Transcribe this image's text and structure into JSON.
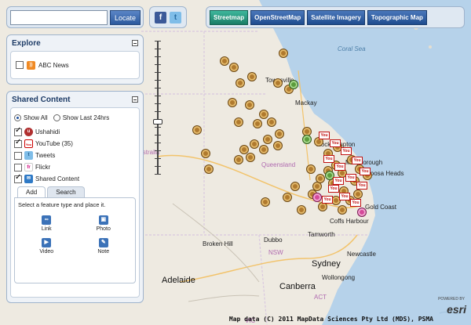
{
  "search": {
    "placeholder": "",
    "value": "",
    "locate_label": "Locate"
  },
  "social": {
    "facebook_glyph": "f",
    "twitter_glyph": "t"
  },
  "basemaps": [
    {
      "label": "Streetmap",
      "active": true
    },
    {
      "label": "OpenStreetMap",
      "active": false
    },
    {
      "label": "Satellite Imagery",
      "active": false
    },
    {
      "label": "Topographic Map",
      "active": false
    }
  ],
  "explore": {
    "title": "Explore",
    "items": [
      {
        "label": "ABC News",
        "checked": false,
        "icon": "rss-icon"
      }
    ]
  },
  "shared": {
    "title": "Shared Content",
    "filters": [
      {
        "label": "Show All",
        "selected": true
      },
      {
        "label": "Show Last 24hrs",
        "selected": false
      }
    ],
    "items": [
      {
        "label": "Ushahidi",
        "checked": true,
        "icon": "ushahidi-icon"
      },
      {
        "label": "YouTube (35)",
        "checked": true,
        "icon": "youtube-icon"
      },
      {
        "label": "Tweets",
        "checked": false,
        "icon": "tweets-icon"
      },
      {
        "label": "Flickr",
        "checked": false,
        "icon": "flickr-icon"
      },
      {
        "label": "Shared Content",
        "checked": true,
        "icon": "shared-icon"
      }
    ],
    "tabs": [
      {
        "label": "Add",
        "active": true
      },
      {
        "label": "Search",
        "active": false
      }
    ],
    "instructions": "Select a feature type and place it.",
    "features": [
      {
        "label": "Link"
      },
      {
        "label": "Photo"
      },
      {
        "label": "Video"
      },
      {
        "label": "Note"
      }
    ]
  },
  "map": {
    "labels": {
      "coral_sea": "Coral Sea",
      "townsville": "Townsville",
      "mackay": "Mackay",
      "rockhampton": "Rockhampton",
      "australia": "Australia",
      "queensland": "Queensland",
      "maryborough": "Maryborough",
      "noosa_heads": "Noosa Heads",
      "gold_coast": "Gold Coast",
      "coffs_harbour": "Coffs Harbour",
      "tamworth": "Tamworth",
      "dubbo": "Dubbo",
      "broken_hill": "Broken Hill",
      "nsw": "NSW",
      "newcastle": "Newcastle",
      "sydney": "Sydney",
      "wollongong": "Wollongong",
      "canberra": "Canberra",
      "act": "ACT",
      "adelaide": "Adelaide",
      "vic": "VIC"
    },
    "attribution": "Map data (C) 2011 MapData Sciences Pty Ltd (MDS), PSMA",
    "logo": "esri",
    "logo_powered": "POWERED BY"
  },
  "colors": {
    "accent": "#2c5a9e",
    "active_basemap": "#1a7d66",
    "ocean": "#b6d2ea",
    "land": "#eeeae1"
  }
}
